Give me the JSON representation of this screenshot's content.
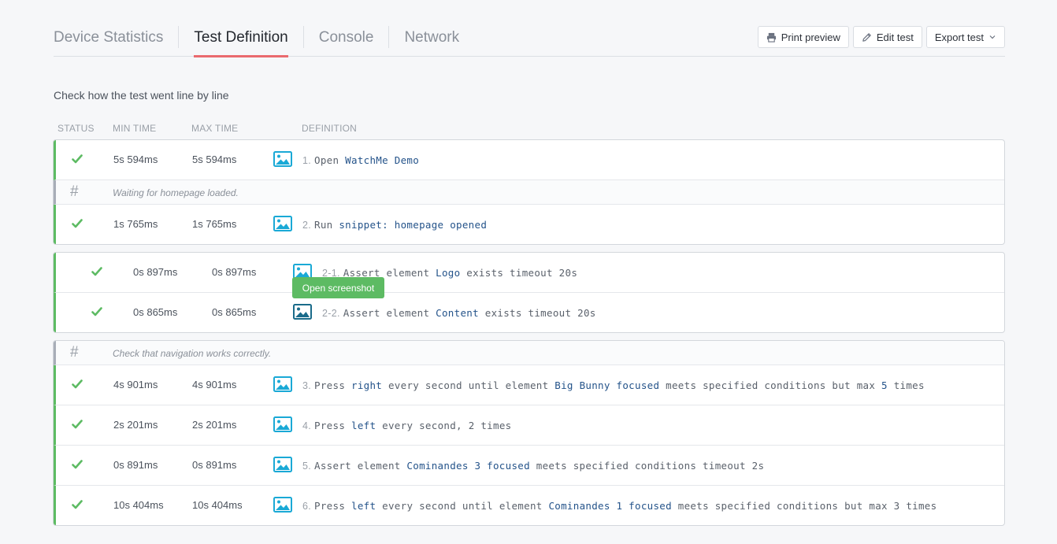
{
  "tabs": [
    {
      "label": "Device Statistics"
    },
    {
      "label": "Test Definition"
    },
    {
      "label": "Console"
    },
    {
      "label": "Network"
    }
  ],
  "actions": {
    "print": "Print preview",
    "edit": "Edit test",
    "export": "Export test"
  },
  "subtitle": "Check how the test went line by line",
  "headers": {
    "status": "STATUS",
    "min": "MIN TIME",
    "max": "MAX TIME",
    "definition": "DEFINITION"
  },
  "rows": [
    {
      "num": "1.",
      "min": "5s 594ms",
      "max": "5s 594ms",
      "parts": [
        {
          "t": "Open "
        },
        {
          "t": "WatchMe Demo",
          "hl": true
        }
      ]
    },
    {
      "comment": "Waiting for homepage loaded."
    },
    {
      "num": "2.",
      "min": "1s 765ms",
      "max": "1s 765ms",
      "parts": [
        {
          "t": "Run "
        },
        {
          "t": "snippet: homepage opened",
          "hl": true
        }
      ]
    },
    {
      "num": "2-1.",
      "min": "0s 897ms",
      "max": "0s 897ms",
      "parts": [
        {
          "t": "Assert element "
        },
        {
          "t": "Logo",
          "hl": true
        },
        {
          "t": " exists timeout 20s"
        }
      ]
    },
    {
      "num": "2-2.",
      "min": "0s 865ms",
      "max": "0s 865ms",
      "parts": [
        {
          "t": "Assert element "
        },
        {
          "t": "Content",
          "hl": true
        },
        {
          "t": " exists timeout 20s"
        }
      ]
    },
    {
      "comment": "Check that navigation works correctly."
    },
    {
      "num": "3.",
      "min": "4s 901ms",
      "max": "4s 901ms",
      "parts": [
        {
          "t": "Press "
        },
        {
          "t": "right",
          "hl": true
        },
        {
          "t": " every second until element "
        },
        {
          "t": "Big Bunny focused",
          "hl": true
        },
        {
          "t": " meets specified conditions but max "
        },
        {
          "t": "5",
          "hl": true
        },
        {
          "t": " times"
        }
      ]
    },
    {
      "num": "4.",
      "min": "2s 201ms",
      "max": "2s 201ms",
      "parts": [
        {
          "t": "Press "
        },
        {
          "t": "left",
          "hl": true
        },
        {
          "t": " every second, 2 times"
        }
      ]
    },
    {
      "num": "5.",
      "min": "0s 891ms",
      "max": "0s 891ms",
      "parts": [
        {
          "t": "Assert element "
        },
        {
          "t": "Cominandes 3 focused",
          "hl": true
        },
        {
          "t": " meets specified conditions timeout 2s"
        }
      ]
    },
    {
      "num": "6.",
      "min": "10s 404ms",
      "max": "10s 404ms",
      "parts": [
        {
          "t": "Press "
        },
        {
          "t": "left",
          "hl": true
        },
        {
          "t": " every second until element "
        },
        {
          "t": "Cominandes 1 focused",
          "hl": true
        },
        {
          "t": " meets specified conditions but max 3 times"
        }
      ]
    }
  ],
  "tooltip": "Open screenshot",
  "colors": {
    "accent_tab": "#ea6a6e",
    "success": "#5dbb63",
    "icon": "#1aa9d6",
    "icon_active": "#1a6b8a",
    "highlight": "#24538a"
  }
}
